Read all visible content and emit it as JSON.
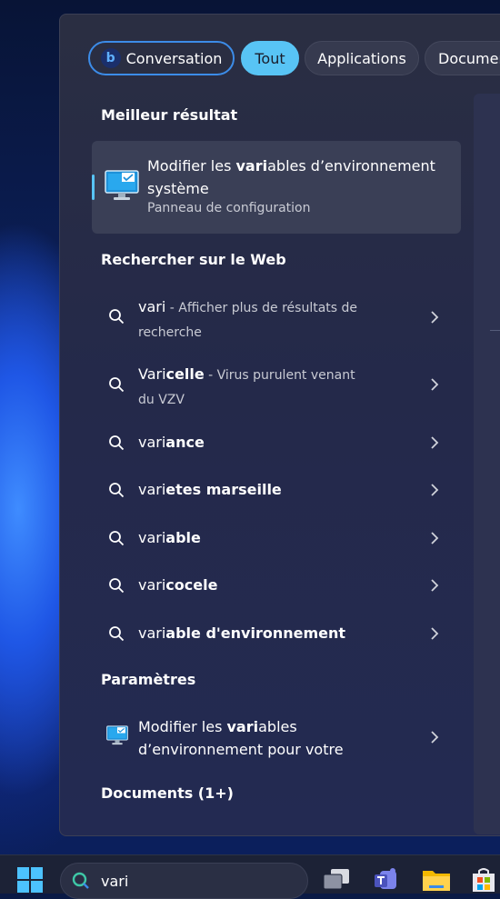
{
  "tabs": [
    {
      "label": "Conversation",
      "active": false
    },
    {
      "label": "Tout",
      "active": true
    },
    {
      "label": "Applications",
      "active": false
    },
    {
      "label": "Documen",
      "active": false
    }
  ],
  "best_match": {
    "heading": "Meilleur résultat",
    "title_bold": "vari",
    "title_prefix": "Modifier les ",
    "title_suffix": "ables d’environnement système",
    "subtitle": "Panneau de configuration"
  },
  "web": {
    "heading": "Rechercher sur le Web",
    "items": [
      {
        "prefix": "vari",
        "rest": "",
        "desc": " - Afficher plus de résultats de recherche"
      },
      {
        "prefix": "Vari",
        "rest": "celle",
        "desc": " - Virus purulent venant du VZV"
      },
      {
        "prefix": "vari",
        "rest": "ance",
        "desc": ""
      },
      {
        "prefix": "vari",
        "rest": "etes marseille",
        "desc": ""
      },
      {
        "prefix": "vari",
        "rest": "able",
        "desc": ""
      },
      {
        "prefix": "vari",
        "rest": "cocele",
        "desc": ""
      },
      {
        "prefix": "vari",
        "rest": "able d'environnement",
        "desc": ""
      }
    ]
  },
  "settings": {
    "heading": "Paramètres",
    "item_prefix": "Modifier les ",
    "item_bold": "vari",
    "item_suffix": "ables d’environnement pour votre"
  },
  "documents": {
    "heading": "Documents (1+)"
  },
  "taskbar": {
    "search_query": "vari"
  },
  "colors": {
    "accent": "#58c4f5",
    "panel": "#2a2e42",
    "selected": "#3a3f56"
  }
}
